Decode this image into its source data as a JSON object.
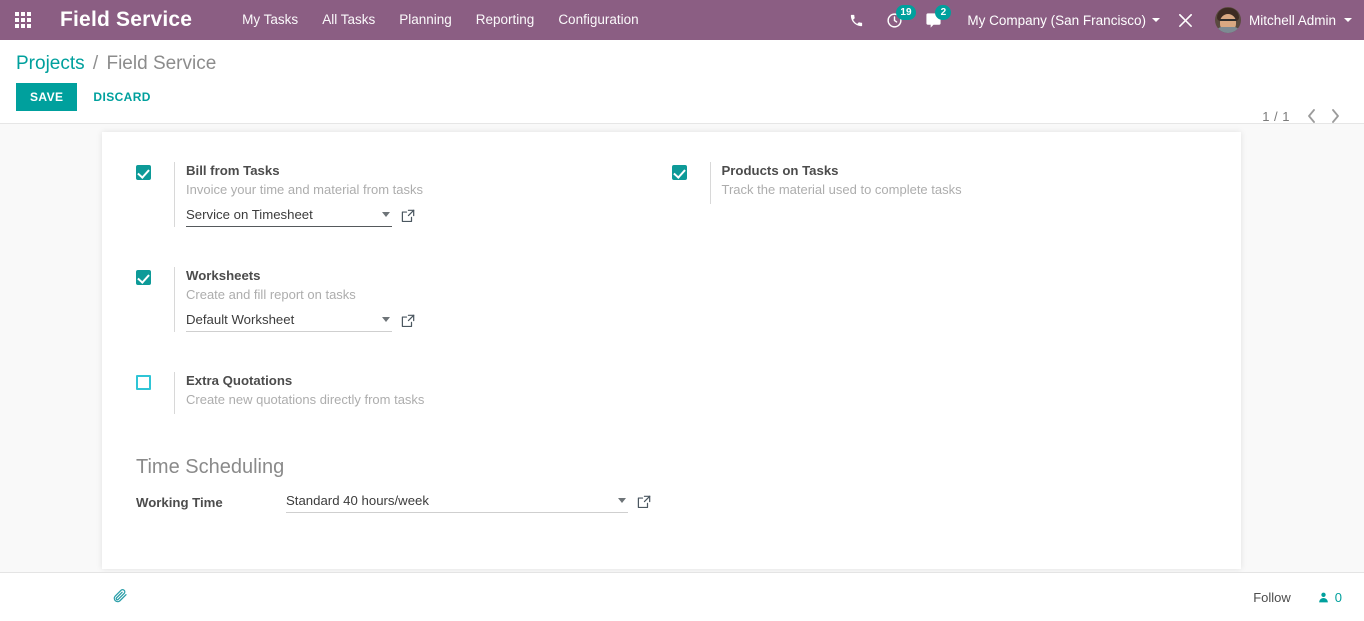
{
  "navbar": {
    "apps_icon": "grid-apps-icon",
    "brand": "Field Service",
    "menu": [
      {
        "label": "My Tasks"
      },
      {
        "label": "All Tasks"
      },
      {
        "label": "Planning"
      },
      {
        "label": "Reporting"
      },
      {
        "label": "Configuration"
      }
    ],
    "icons": {
      "phone": "phone-icon",
      "activity": "clock-activity-icon",
      "activity_count": "19",
      "messages": "chat-bubble-icon",
      "messages_count": "2",
      "debug": "tools-wrench-icon"
    },
    "company": "My Company (San Francisco)",
    "user": "Mitchell Admin",
    "accent_badge_color": "#00A09D",
    "background_color": "#8b5e83"
  },
  "control_panel": {
    "breadcrumb_root": "Projects",
    "breadcrumb_separator": "/",
    "breadcrumb_current": "Field Service",
    "save_label": "SAVE",
    "discard_label": "DISCARD",
    "pager_count": "1 / 1",
    "pager_prev": "‹",
    "pager_next": "›",
    "save_color": "#00A09D"
  },
  "settings": {
    "left": [
      {
        "key": "bill_from_tasks",
        "title": "Bill from Tasks",
        "description": "Invoice your time and material from tasks",
        "checked": true,
        "field_value": "Service on Timesheet",
        "has_field": true,
        "underline": "strong"
      },
      {
        "key": "worksheets",
        "title": "Worksheets",
        "description": "Create and fill report on tasks",
        "checked": true,
        "field_value": "Default Worksheet",
        "has_field": true,
        "underline": "soft"
      },
      {
        "key": "extra_quotations",
        "title": "Extra Quotations",
        "description": "Create new quotations directly from tasks",
        "checked": false,
        "has_field": false
      }
    ],
    "right": [
      {
        "key": "products_on_tasks",
        "title": "Products on Tasks",
        "description": "Track the material used to complete tasks",
        "checked": true,
        "has_field": false
      }
    ]
  },
  "time_scheduling": {
    "heading": "Time Scheduling",
    "working_time_label": "Working Time",
    "working_time_value": "Standard 40 hours/week"
  },
  "chatter": {
    "attachment_icon": "paperclip-icon",
    "follow_label": "Follow",
    "followers_icon": "user-follower-icon",
    "followers_count": "0",
    "accent_color": "#00A09D"
  }
}
